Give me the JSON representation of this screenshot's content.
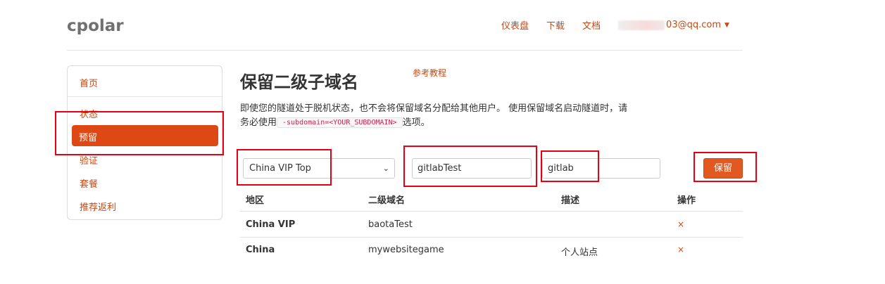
{
  "header": {
    "logo": "cpolar",
    "nav": [
      "仪表盘",
      "下载",
      "文档"
    ],
    "user_email": "03@qq.com",
    "user_caret": "▼"
  },
  "sidebar": {
    "items": [
      "首页",
      "状态",
      "预留",
      "验证",
      "套餐",
      "推荐返利"
    ],
    "active_index": 2
  },
  "main": {
    "title": "保留二级子域名",
    "ref_link": "参考教程",
    "desc_before": "即使您的隧道处于脱机状态，也不会将保留域名分配给其他用户。 使用保留域名启动隧道时，请务必使用",
    "desc_code": "-subdomain=<YOUR_SUBDOMAIN>",
    "desc_after": "选项。"
  },
  "form": {
    "region_selected": "China VIP Top",
    "subdomain_value": "gitlabTest",
    "description_value": "gitlab",
    "submit_label": "保留"
  },
  "table": {
    "headers": [
      "地区",
      "二级域名",
      "描述",
      "操作"
    ],
    "rows": [
      {
        "region": "China VIP",
        "subdomain": "baotaTest",
        "desc": "",
        "action": "×"
      },
      {
        "region": "China",
        "subdomain": "mywebsitegame",
        "desc": "个人站点",
        "action": "×"
      }
    ]
  },
  "colors": {
    "accent": "#dd4814",
    "link": "#c84813",
    "highlight": "#e60012"
  }
}
